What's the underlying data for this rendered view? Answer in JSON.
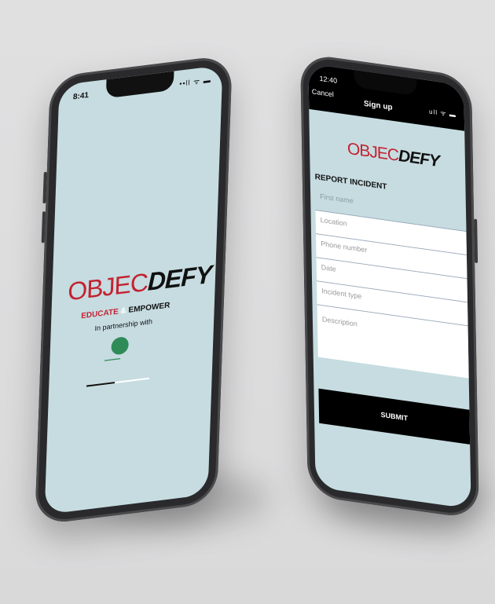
{
  "left_phone": {
    "status_time": "8:41",
    "status_icons": "••ll ᯤ ▬",
    "logo_part1": "OBJEC",
    "logo_part2": "DEFY",
    "tagline_educate": "EDUCATE",
    "tagline_amp": "&",
    "tagline_empower": "EMPOWER",
    "partnership_text": "In partnership with",
    "loading_progress": 0.45
  },
  "right_phone": {
    "status_time": "12:40",
    "cancel_label": "Cancel",
    "title": "Sign up",
    "status_icons": "ull ᯤ ▬",
    "logo_part1": "OBJEC",
    "logo_part2": "DEFY",
    "form_heading": "REPORT INCIDENT",
    "fields": [
      {
        "placeholder": "First name"
      },
      {
        "placeholder": "Location"
      },
      {
        "placeholder": "Phone number"
      },
      {
        "placeholder": "Date"
      },
      {
        "placeholder": "Incident type"
      },
      {
        "placeholder": "Description"
      }
    ],
    "submit_label": "SUBMIT"
  },
  "colors": {
    "brand_red": "#c4222f",
    "screen_bg": "#c6dce1",
    "frame": "#2a2a2c"
  }
}
